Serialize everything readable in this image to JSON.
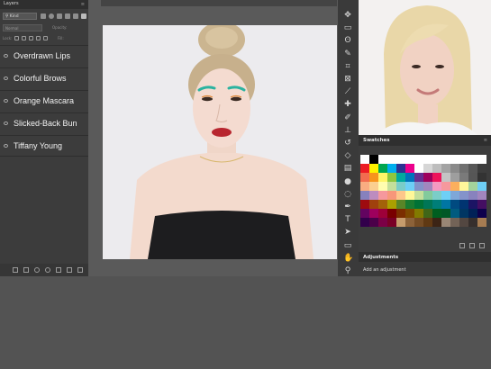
{
  "layers_panel": {
    "tab_label": "Layers",
    "kind_label": "Kind",
    "blend_mode": "Normal",
    "opacity_label": "Opacity:",
    "lock_label": "Lock:",
    "fill_label": "Fill:",
    "layers": [
      {
        "name": "Overdrawn Lips"
      },
      {
        "name": "Colorful Brows"
      },
      {
        "name": "Orange Mascara"
      },
      {
        "name": "Slicked-Back Bun"
      },
      {
        "name": "Tiffany Young"
      }
    ]
  },
  "swatches_panel": {
    "title": "Swatches",
    "menu": "≡"
  },
  "adjustments_panel": {
    "title": "Adjustments",
    "subtitle": "Add an adjustment"
  },
  "tools": [
    {
      "icon": "move-icon",
      "glyph": "✥"
    },
    {
      "icon": "marquee-icon",
      "glyph": "▭"
    },
    {
      "icon": "lasso-icon",
      "glyph": "ʘ"
    },
    {
      "icon": "quick-select-icon",
      "glyph": "✎"
    },
    {
      "icon": "crop-icon",
      "glyph": "⌗"
    },
    {
      "icon": "frame-icon",
      "glyph": "⊠"
    },
    {
      "icon": "eyedropper-icon",
      "glyph": "⟋"
    },
    {
      "icon": "healing-brush-icon",
      "glyph": "✚"
    },
    {
      "icon": "brush-icon",
      "glyph": "✐"
    },
    {
      "icon": "clone-stamp-icon",
      "glyph": "⊥"
    },
    {
      "icon": "history-brush-icon",
      "glyph": "↺"
    },
    {
      "icon": "eraser-icon",
      "glyph": "◇"
    },
    {
      "icon": "gradient-icon",
      "glyph": "▤"
    },
    {
      "icon": "blur-icon",
      "glyph": "●"
    },
    {
      "icon": "dodge-icon",
      "glyph": "◌"
    },
    {
      "icon": "pen-icon",
      "glyph": "✒"
    },
    {
      "icon": "type-icon",
      "glyph": "T"
    },
    {
      "icon": "path-select-icon",
      "glyph": "➤"
    },
    {
      "icon": "rectangle-icon",
      "glyph": "▭"
    },
    {
      "icon": "hand-icon",
      "glyph": "✋"
    },
    {
      "icon": "zoom-icon",
      "glyph": "⚲"
    }
  ],
  "swatch_colors": [
    [
      "#ffffff",
      "#000000",
      "#ffffff",
      "#ffffff",
      "#ffffff",
      "#ffffff",
      "#ffffff",
      "#ffffff",
      "#ffffff",
      "#ffffff",
      "#ffffff",
      "#ffffff",
      "#ffffff",
      "#ffffff"
    ],
    [
      "#ec1c24",
      "#fff200",
      "#00a651",
      "#00aeef",
      "#2e3192",
      "#ec008c",
      "#ffffff",
      "#d6d6d6",
      "#bdbdbd",
      "#a3a3a3",
      "#8a8a8a",
      "#707070",
      "#575757",
      "#3d3d3d"
    ],
    [
      "#f26c4f",
      "#f7941d",
      "#fff568",
      "#8dc63f",
      "#00a99d",
      "#0072bc",
      "#662d91",
      "#9e005d",
      "#ed145b",
      "#c4c4c4",
      "#9e9e9e",
      "#7a7a7a",
      "#565656",
      "#333333"
    ],
    [
      "#f9ad81",
      "#fbcf90",
      "#fffdaf",
      "#c4df9b",
      "#7accc8",
      "#6dcff6",
      "#8393ca",
      "#a187be",
      "#f49ac1",
      "#f6989d",
      "#fbaf5d",
      "#fff79a",
      "#a3d39c",
      "#6ecff6"
    ],
    [
      "#8781bd",
      "#bd8cbf",
      "#f5989d",
      "#f7977a",
      "#fdc68a",
      "#fff799",
      "#c4df9b",
      "#82ca9c",
      "#7bcdc8",
      "#6ecff6",
      "#7ea7d8",
      "#8493ca",
      "#8882be",
      "#a186be"
    ],
    [
      "#9e0b0f",
      "#a0410d",
      "#a36209",
      "#aba000",
      "#598527",
      "#1a7b30",
      "#007236",
      "#007656",
      "#007e79",
      "#0076a3",
      "#004a80",
      "#003471",
      "#1b1464",
      "#440e62"
    ],
    [
      "#630460",
      "#9e005d",
      "#9e0039",
      "#790000",
      "#7b2e00",
      "#7d4900",
      "#827b00",
      "#406618",
      "#005e20",
      "#005826",
      "#005b7f",
      "#003663",
      "#002157",
      "#0d004c"
    ],
    [
      "#32004b",
      "#4b0049",
      "#7b0046",
      "#7a0026",
      "#c69c6d",
      "#8c6239",
      "#754c24",
      "#603913",
      "#3c2415",
      "#998675",
      "#736357",
      "#534741",
      "#362f2d",
      "#a67c52"
    ]
  ]
}
